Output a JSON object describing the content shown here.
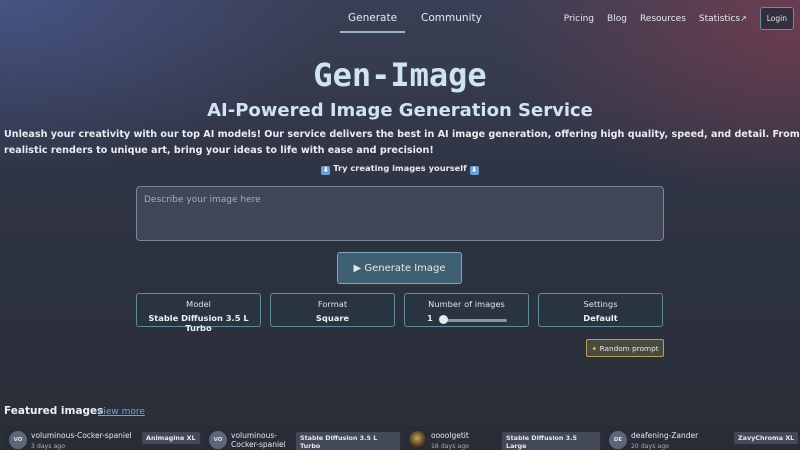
{
  "nav": {
    "center": [
      "Generate",
      "Community"
    ],
    "right": [
      "Pricing",
      "Blog",
      "Resources",
      "Statistics"
    ],
    "login": "Login"
  },
  "hero": {
    "title": "Gen-Image",
    "subtitle": "AI-Powered Image Generation Service",
    "description": "Unleash your creativity with our top AI models! Our service delivers the best in AI image generation, offering high quality, speed, and detail. From realistic renders to unique art, bring your ideas to life with ease and precision!",
    "try_text": "Try creating images yourself",
    "try_emoji": "⬇"
  },
  "prompt": {
    "placeholder": "Describe your image here"
  },
  "generate": {
    "label": "Generate Image",
    "icon": "▶"
  },
  "options": {
    "model": {
      "label": "Model",
      "value": "Stable Diffusion 3.5 L Turbo"
    },
    "format": {
      "label": "Format",
      "value": "Square"
    },
    "count": {
      "label": "Number of images",
      "value": "1"
    },
    "settings": {
      "label": "Settings",
      "value": "Default"
    }
  },
  "random": {
    "label": "Random prompt"
  },
  "featured": {
    "title": "Featured images",
    "view_more": "view more",
    "cards": [
      {
        "initials": "VO",
        "user": "voluminous-Cocker-spaniel",
        "time": "3 days ago",
        "model": "Animagine XL"
      },
      {
        "initials": "VO",
        "user": "voluminous-Cocker-spaniel",
        "time": "",
        "model": "Stable Diffusion 3.5 L Turbo"
      },
      {
        "initials": "",
        "user": "oooolgetit",
        "time": "16 days ago",
        "model": "Stable Diffusion 3.5 Large"
      },
      {
        "initials": "DE",
        "user": "deafening-Zander",
        "time": "20 days ago",
        "model": "ZavyChroma XL"
      }
    ]
  },
  "colors": {
    "accent": "#3f5f72",
    "link": "#6aa7e8",
    "title": "#cfe3f2"
  }
}
